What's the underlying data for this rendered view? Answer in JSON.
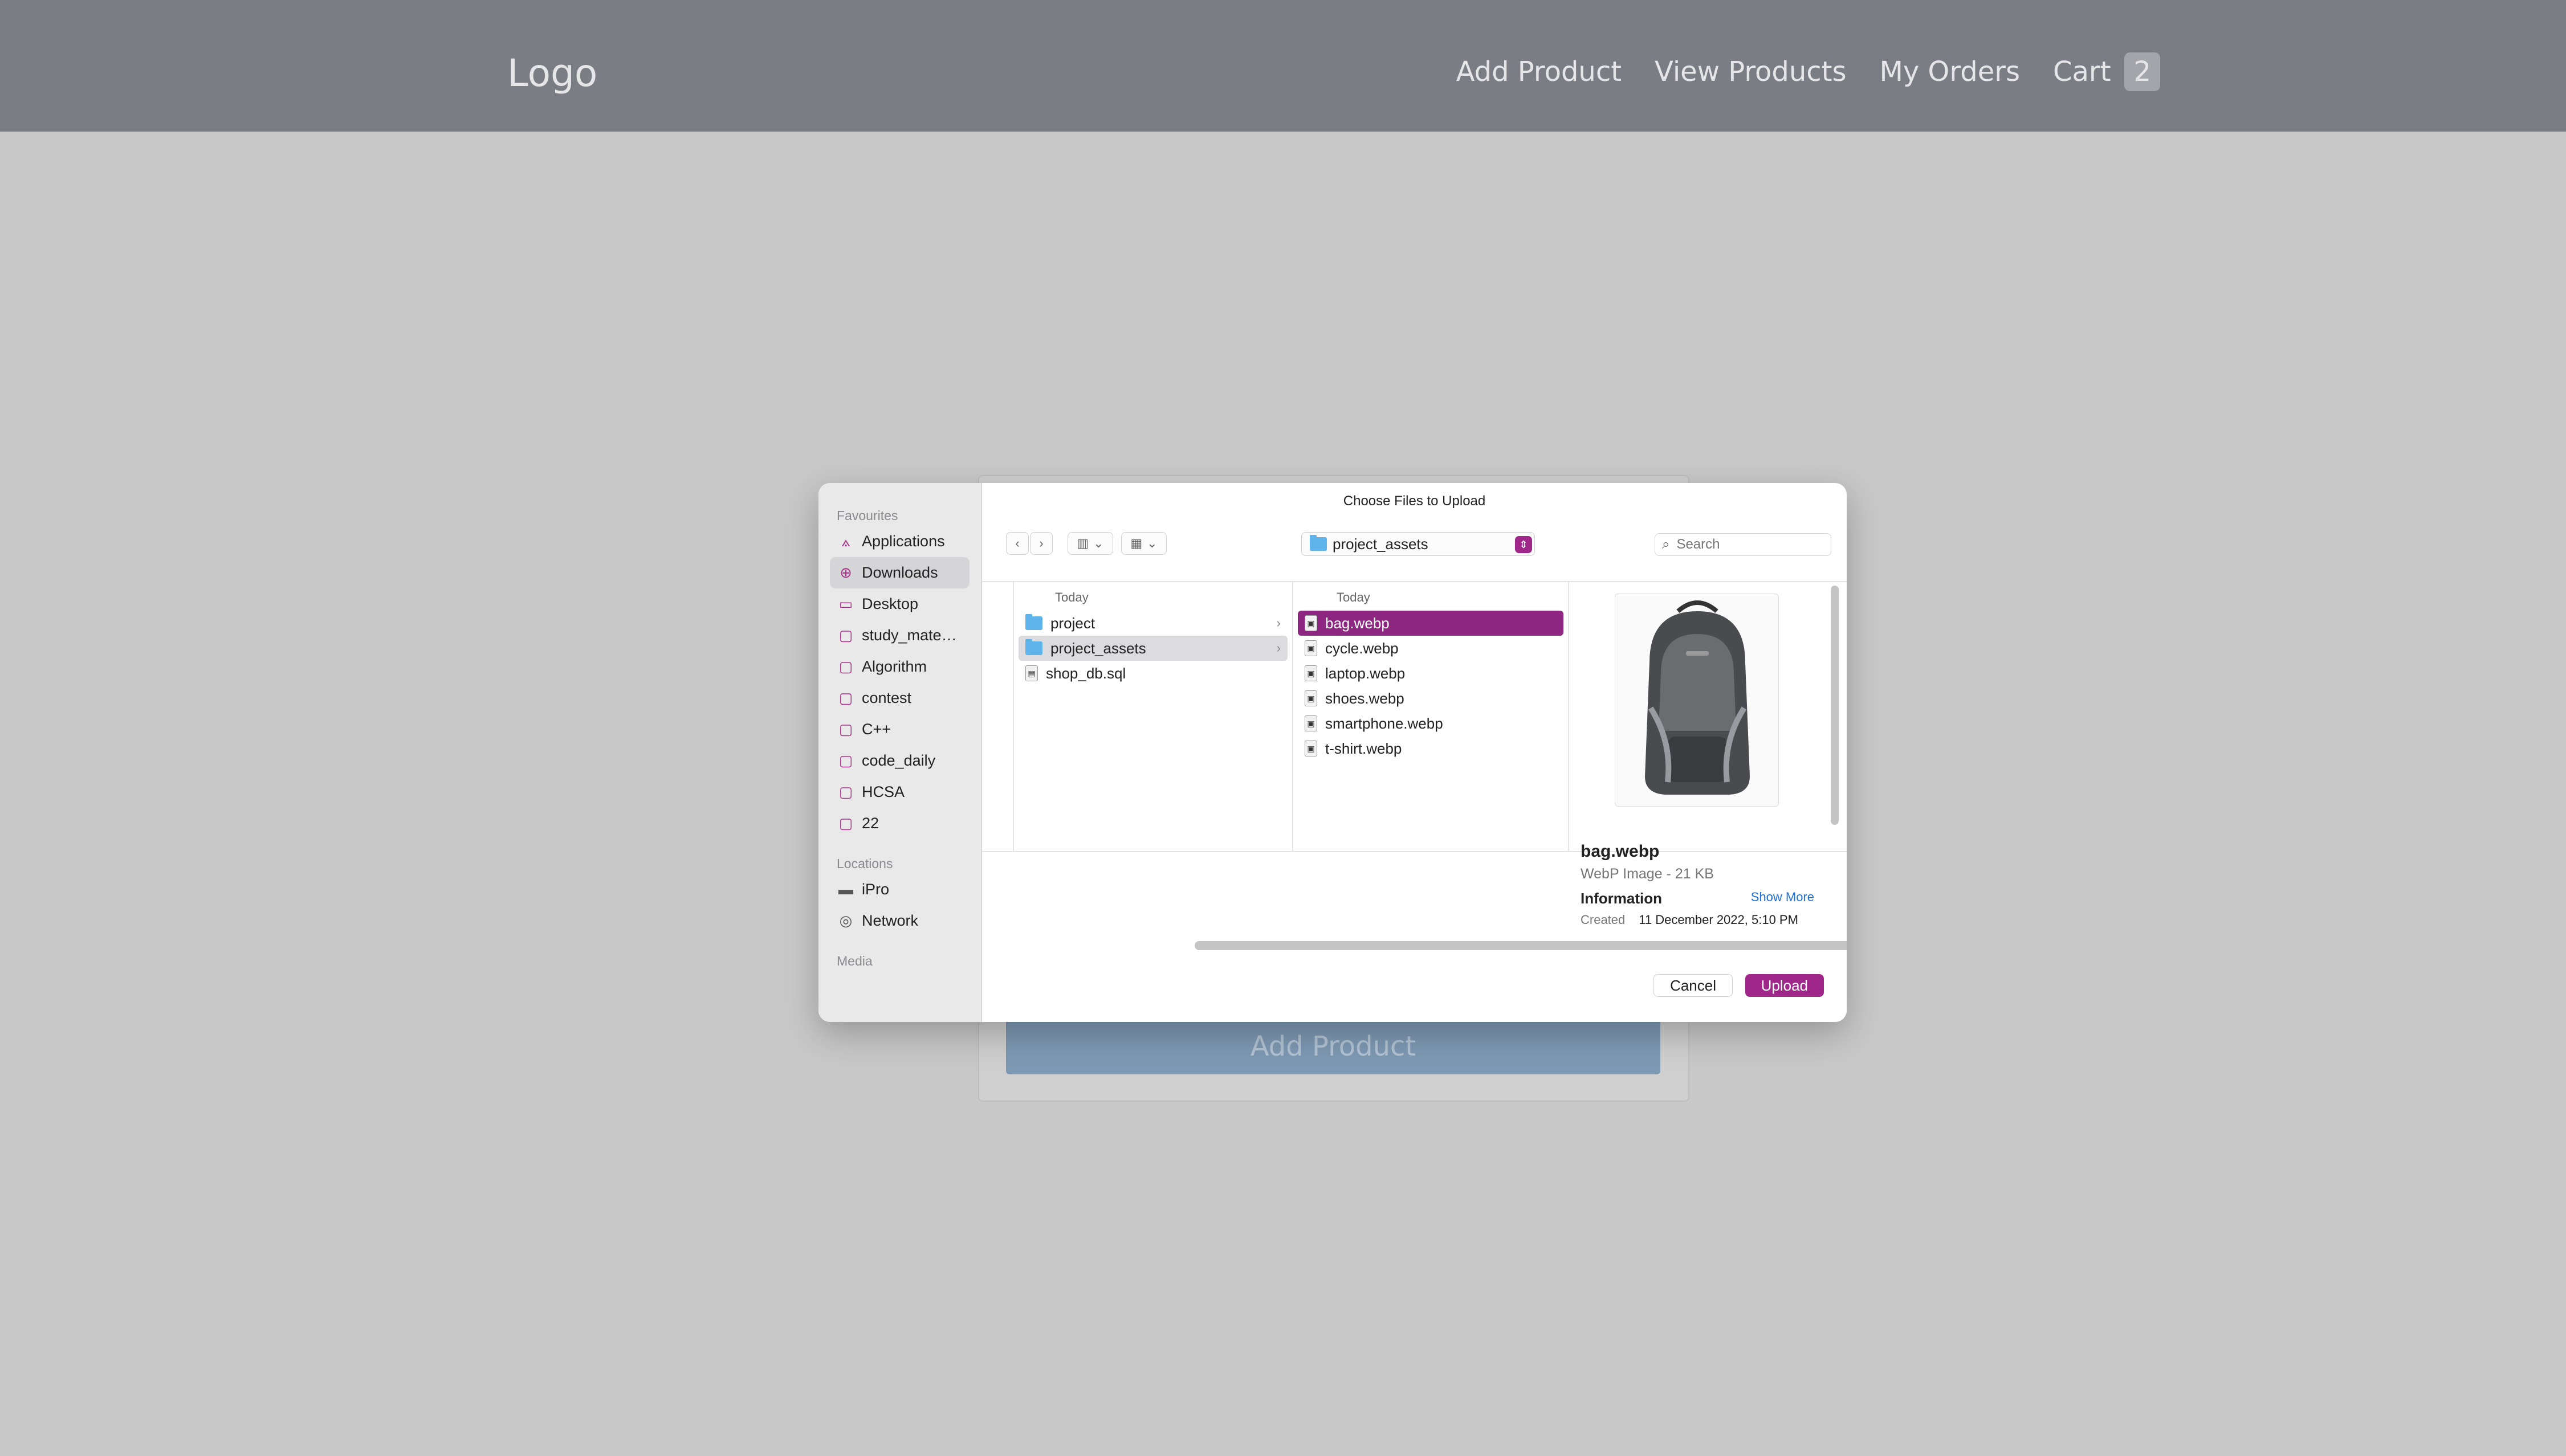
{
  "header": {
    "logo": "Logo",
    "nav": [
      "Add Product",
      "View Products",
      "My Orders"
    ],
    "cart_label": "Cart",
    "cart_count": "2"
  },
  "page": {
    "add_product_button": "Add Product"
  },
  "dialog": {
    "title": "Choose Files to Upload",
    "sidebar": {
      "favourites_label": "Favourites",
      "favourites": [
        "Applications",
        "Downloads",
        "Desktop",
        "study_mate…",
        "Algorithm",
        "contest",
        "C++",
        "code_daily",
        "HCSA",
        "22"
      ],
      "locations_label": "Locations",
      "locations": [
        "iPro",
        "Network"
      ],
      "media_label": "Media"
    },
    "path": "project_assets",
    "search_placeholder": "Search",
    "column1": {
      "header": "Today",
      "items": [
        "project",
        "project_assets",
        "shop_db.sql"
      ]
    },
    "column2": {
      "header": "Today",
      "items": [
        "bag.webp",
        "cycle.webp",
        "laptop.webp",
        "shoes.webp",
        "smartphone.webp",
        "t-shirt.webp"
      ]
    },
    "preview": {
      "name": "bag.webp",
      "kind": "WebP Image - 21 KB",
      "info_label": "Information",
      "show_more": "Show More",
      "created_label": "Created",
      "created_value": "11 December 2022, 5:10 PM"
    },
    "cancel": "Cancel",
    "upload": "Upload"
  }
}
